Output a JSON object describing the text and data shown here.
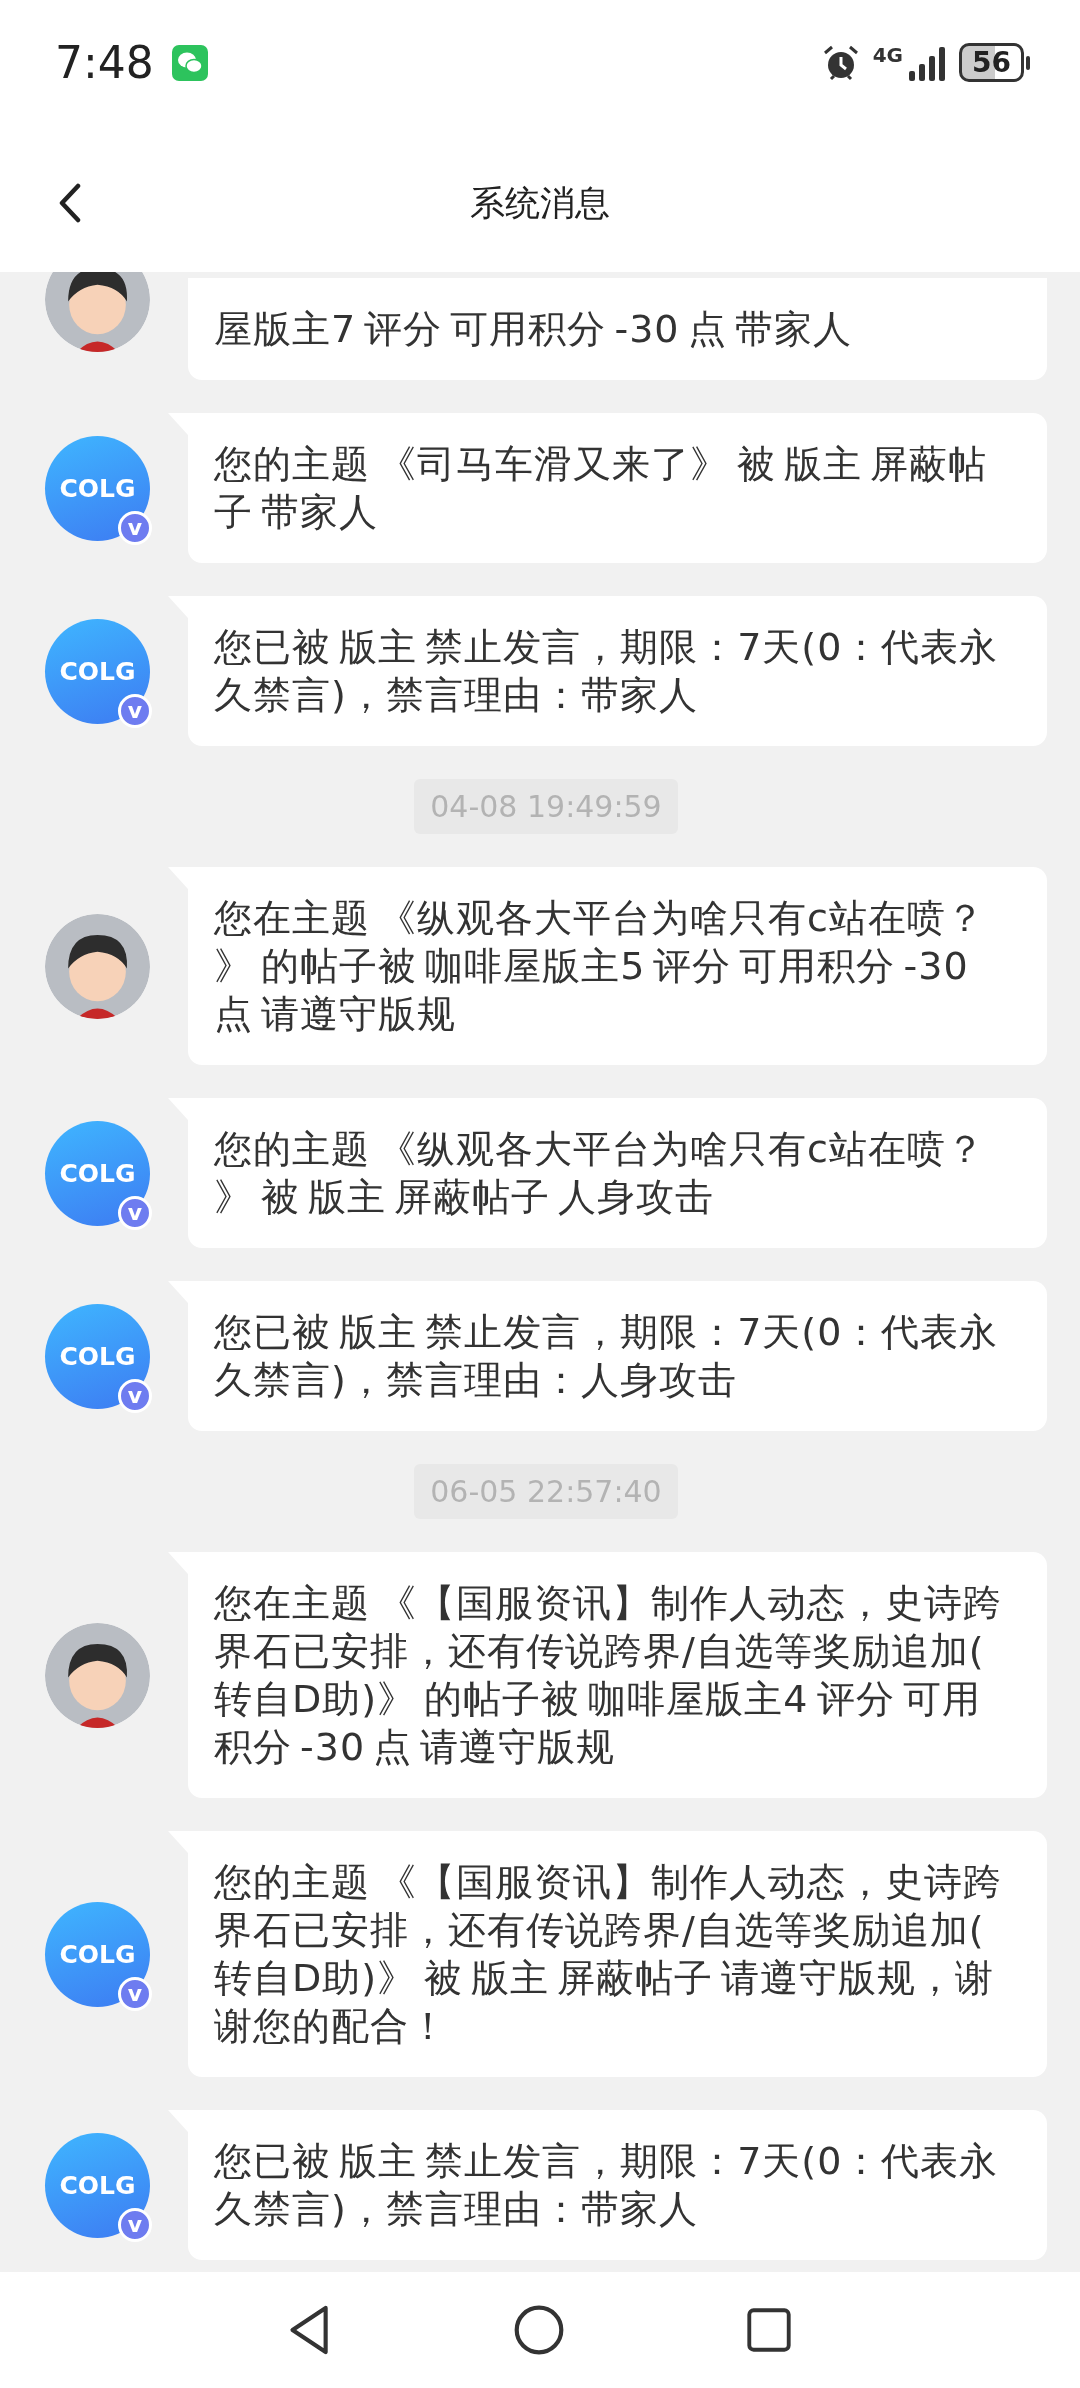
{
  "status_bar": {
    "time": "7:48",
    "network": "4G",
    "battery": "56"
  },
  "header": {
    "title": "系统消息"
  },
  "feed": [
    {
      "kind": "user_message",
      "cut": true,
      "text": "屋版主7 评分 可用积分 -30 点 带家人"
    },
    {
      "kind": "system_message",
      "cut": false,
      "logo": "COLG",
      "badge": "v",
      "text": "您的主题 《司马车滑又来了》 被 版主 屏蔽帖子 带家人"
    },
    {
      "kind": "system_message",
      "cut": false,
      "logo": "COLG",
      "badge": "v",
      "text": "您已被 版主 禁止发言，期限：7天(0：代表永久禁言)，禁言理由：带家人"
    },
    {
      "kind": "time",
      "text": "04-08 19:49:59"
    },
    {
      "kind": "user_message",
      "cut": false,
      "text": "您在主题 《纵观各大平台为啥只有c站在喷？》 的帖子被 咖啡屋版主5 评分 可用积分 -30 点 请遵守版规"
    },
    {
      "kind": "system_message",
      "cut": false,
      "logo": "COLG",
      "badge": "v",
      "text": "您的主题 《纵观各大平台为啥只有c站在喷？》 被 版主 屏蔽帖子 人身攻击"
    },
    {
      "kind": "system_message",
      "cut": false,
      "logo": "COLG",
      "badge": "v",
      "text": "您已被 版主 禁止发言，期限：7天(0：代表永久禁言)，禁言理由：人身攻击"
    },
    {
      "kind": "time",
      "text": "06-05 22:57:40"
    },
    {
      "kind": "user_message",
      "cut": false,
      "text": "您在主题 《【国服资讯】制作人动态，史诗跨界石已安排，还有传说跨界/自选等奖励追加(转自D助)》 的帖子被 咖啡屋版主4 评分 可用积分 -30 点 请遵守版规"
    },
    {
      "kind": "system_message",
      "cut": false,
      "logo": "COLG",
      "badge": "v",
      "text": "您的主题 《【国服资讯】制作人动态，史诗跨界石已安排，还有传说跨界/自选等奖励追加(转自D助)》 被 版主 屏蔽帖子 请遵守版规，谢谢您的配合！"
    },
    {
      "kind": "system_message",
      "cut": false,
      "logo": "COLG",
      "badge": "v",
      "text": "您已被 版主 禁止发言，期限：7天(0：代表永久禁言)，禁言理由：带家人"
    }
  ]
}
